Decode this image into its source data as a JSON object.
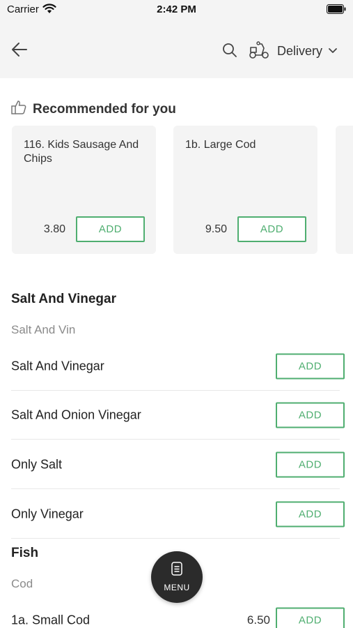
{
  "status_bar": {
    "carrier": "Carrier",
    "time": "2:42 PM"
  },
  "header": {
    "delivery_label": "Delivery"
  },
  "recommended": {
    "title": "Recommended for you",
    "items": [
      {
        "name": "116. Kids Sausage And Chips",
        "price": "3.80",
        "add_label": "ADD"
      },
      {
        "name": "1b. Large Cod",
        "price": "9.50",
        "add_label": "ADD"
      }
    ]
  },
  "sections": [
    {
      "title": "Salt And Vinegar",
      "subtitle": "Salt And Vin",
      "items": [
        {
          "name": "Salt And Vinegar",
          "price": "",
          "add_label": "ADD"
        },
        {
          "name": "Salt And Onion Vinegar",
          "price": "",
          "add_label": "ADD"
        },
        {
          "name": "Only Salt",
          "price": "",
          "add_label": "ADD"
        },
        {
          "name": "Only Vinegar",
          "price": "",
          "add_label": "ADD"
        }
      ]
    },
    {
      "title": "Fish",
      "subtitle": "Cod",
      "items": [
        {
          "name": "1a. Small Cod",
          "price": "6.50",
          "add_label": "ADD"
        }
      ]
    }
  ],
  "menu_button": {
    "label": "MENU"
  },
  "icons": [
    "wifi-icon",
    "battery-icon",
    "back-icon",
    "search-icon",
    "scooter-icon",
    "chevron-down-icon",
    "thumbs-up-icon",
    "menu-icon"
  ],
  "colors": {
    "accent_green": "#4fae70",
    "header_bg": "#f4f4f4",
    "fab_bg": "#2b2b2b"
  }
}
